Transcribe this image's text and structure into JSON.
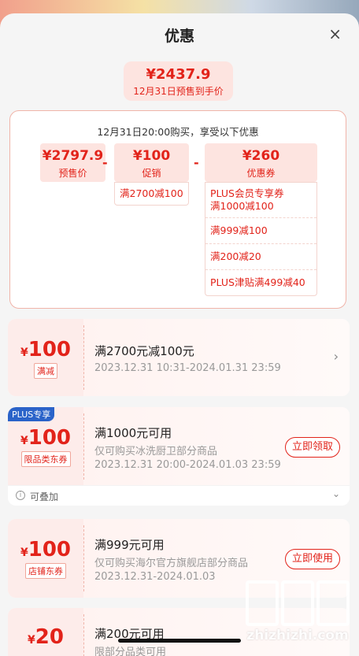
{
  "sheet": {
    "title": "优惠",
    "close_icon": "×"
  },
  "final": {
    "amount": "¥2437.9",
    "label": "12月31日预售到手价"
  },
  "summary": {
    "title": "12月31日20:00购买，享受以下优惠",
    "presale": {
      "value": "¥2797.9",
      "label": "预售价"
    },
    "op1": "-",
    "promo": {
      "value": "¥100",
      "label": "促销",
      "items": [
        "满2700减100"
      ]
    },
    "op2": "-",
    "coupon": {
      "value": "¥260",
      "label": "优惠券",
      "items": [
        "PLUS会员专享券\n满1000减100",
        "满999减100",
        "满200减20",
        "PLUS津贴满499减40"
      ]
    }
  },
  "coupons": [
    {
      "currency": "¥",
      "amount": "100",
      "tag": "满减",
      "title": "满2700元减100元",
      "desc1": "2023.12.31 10:31-2024.01.31 23:59",
      "desc2": ""
    },
    {
      "badge": "PLUS专享",
      "currency": "¥",
      "amount": "100",
      "tag": "限品类东券",
      "title": "满1000元可用",
      "desc1": "仅可购买冰洗厨卫部分商品",
      "desc2": "2023.12.31 20:00-2024.01.03 23:59",
      "button": "立即领取"
    },
    {
      "currency": "¥",
      "amount": "100",
      "tag": "店铺东券",
      "title": "满999元可用",
      "desc1": "仅可购买海尔官方旗舰店部分商品",
      "desc2": "2023.12.31-2024.01.03",
      "button": "立即使用"
    },
    {
      "currency": "¥",
      "amount": "20",
      "tag": "",
      "title": "满200元可用",
      "desc1": "限部分品类可用",
      "desc2": ""
    }
  ],
  "stack": {
    "label": "可叠加",
    "icon": "i"
  },
  "watermark": {
    "text": "zhizhizhi.com"
  }
}
